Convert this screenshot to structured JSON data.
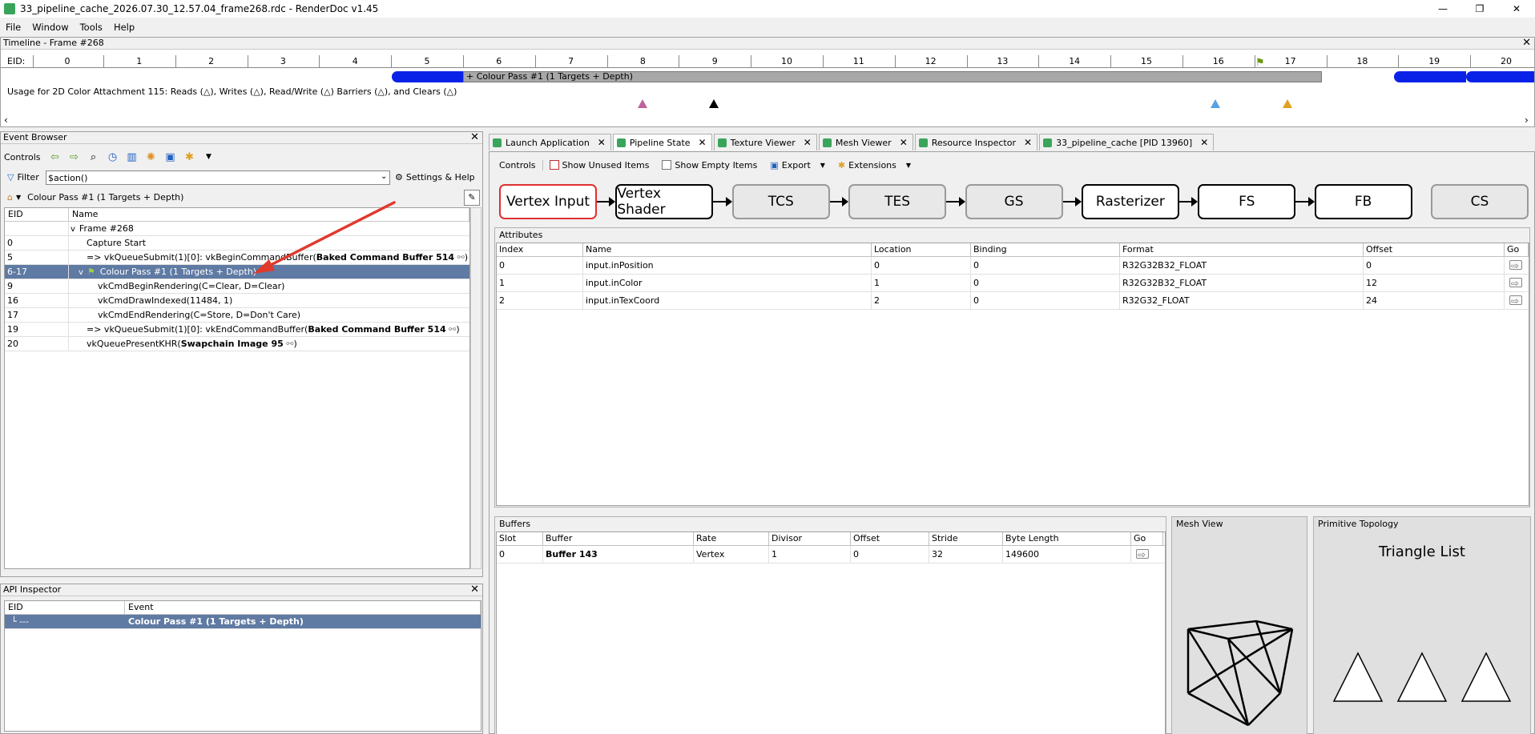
{
  "window": {
    "title": "33_pipeline_cache_2026.07.30_12.57.04_frame268.rdc - RenderDoc v1.45",
    "minimize": "—",
    "maximize": "❐",
    "close": "✕"
  },
  "menu": [
    "File",
    "Window",
    "Tools",
    "Help"
  ],
  "timeline": {
    "header": "Timeline - Frame #268",
    "eid_label": "EID:",
    "ticks": [
      "0",
      "1",
      "2",
      "3",
      "4",
      "5",
      "6",
      "7",
      "8",
      "9",
      "10",
      "11",
      "12",
      "13",
      "14",
      "15",
      "16",
      "17",
      "18",
      "19",
      "20"
    ],
    "pass_label": "+ Colour Pass #1 (1 Targets + Depth)",
    "usage_text": "Usage for 2D Color Attachment 115: Reads (△), Writes (△), Read/Write (△) Barriers (△), and Clears (△)"
  },
  "event_browser": {
    "header": "Event Browser",
    "controls_label": "Controls",
    "filter_label": "Filter",
    "filter_value": "$action()",
    "settings_label": "Settings & Help",
    "breadcrumb": "Colour Pass #1 (1 Targets + Depth)",
    "columns": [
      "EID",
      "Name"
    ],
    "rows": [
      {
        "eid": "",
        "name": "Frame #268",
        "bold": "",
        "tail": "",
        "indent": 0,
        "expander": "v"
      },
      {
        "eid": "0",
        "name": "Capture Start",
        "bold": "",
        "tail": "",
        "indent": 1,
        "expander": ""
      },
      {
        "eid": "5",
        "name": "=> vkQueueSubmit(1)[0]: vkBeginCommandBuffer(",
        "bold": "Baked Command Buffer 514",
        "tail": ")",
        "indent": 1,
        "expander": ""
      },
      {
        "eid": "6-17",
        "name": "Colour Pass #1 (1 Targets + Depth)",
        "bold": "",
        "tail": "",
        "indent": 1,
        "expander": "v",
        "selected": true
      },
      {
        "eid": "9",
        "name": "vkCmdBeginRendering(C=Clear, D=Clear)",
        "bold": "",
        "tail": "",
        "indent": 2,
        "expander": ""
      },
      {
        "eid": "16",
        "name": "vkCmdDrawIndexed(11484, 1)",
        "bold": "",
        "tail": "",
        "indent": 2,
        "expander": ""
      },
      {
        "eid": "17",
        "name": "vkCmdEndRendering(C=Store, D=Don't Care)",
        "bold": "",
        "tail": "",
        "indent": 2,
        "expander": ""
      },
      {
        "eid": "19",
        "name": "=> vkQueueSubmit(1)[0]: vkEndCommandBuffer(",
        "bold": "Baked Command Buffer 514",
        "tail": ")",
        "indent": 1,
        "expander": ""
      },
      {
        "eid": "20",
        "name": "vkQueuePresentKHR(",
        "bold": "Swapchain Image 95",
        "tail": ")",
        "indent": 1,
        "expander": ""
      }
    ]
  },
  "api_inspector": {
    "header": "API Inspector",
    "columns": [
      "EID",
      "Event"
    ],
    "row": {
      "eid": "---",
      "event": "Colour Pass #1 (1 Targets + Depth)"
    }
  },
  "tabs": [
    {
      "label": "Launch Application",
      "active": false
    },
    {
      "label": "Pipeline State",
      "active": true
    },
    {
      "label": "Texture Viewer",
      "active": false
    },
    {
      "label": "Mesh Viewer",
      "active": false
    },
    {
      "label": "Resource Inspector",
      "active": false
    },
    {
      "label": "33_pipeline_cache [PID 13960]",
      "active": false
    }
  ],
  "pipeline": {
    "controls_label": "Controls",
    "show_unused": "Show Unused Items",
    "show_empty": "Show Empty Items",
    "export": "Export",
    "extensions": "Extensions",
    "stages": [
      {
        "label": "Vertex Input",
        "state": "selected"
      },
      {
        "label": "Vertex Shader",
        "state": "active"
      },
      {
        "label": "TCS",
        "state": "disabled"
      },
      {
        "label": "TES",
        "state": "disabled"
      },
      {
        "label": "GS",
        "state": "disabled"
      },
      {
        "label": "Rasterizer",
        "state": "active"
      },
      {
        "label": "FS",
        "state": "active"
      },
      {
        "label": "FB",
        "state": "active"
      },
      {
        "label": "CS",
        "state": "disabled"
      }
    ],
    "attributes": {
      "label": "Attributes",
      "columns": [
        "Index",
        "Name",
        "Location",
        "Binding",
        "Format",
        "Offset",
        "Go"
      ],
      "rows": [
        [
          "0",
          "input.inPosition",
          "0",
          "0",
          "R32G32B32_FLOAT",
          "0"
        ],
        [
          "1",
          "input.inColor",
          "1",
          "0",
          "R32G32B32_FLOAT",
          "12"
        ],
        [
          "2",
          "input.inTexCoord",
          "2",
          "0",
          "R32G32_FLOAT",
          "24"
        ]
      ]
    },
    "buffers": {
      "label": "Buffers",
      "columns": [
        "Slot",
        "Buffer",
        "Rate",
        "Divisor",
        "Offset",
        "Stride",
        "Byte Length",
        "Go"
      ],
      "rows": [
        [
          "0",
          "Buffer 143",
          "Vertex",
          "1",
          "0",
          "32",
          "149600"
        ]
      ]
    },
    "mesh_view_label": "Mesh View",
    "topology_label": "Primitive Topology",
    "topology_value": "Triangle List"
  }
}
